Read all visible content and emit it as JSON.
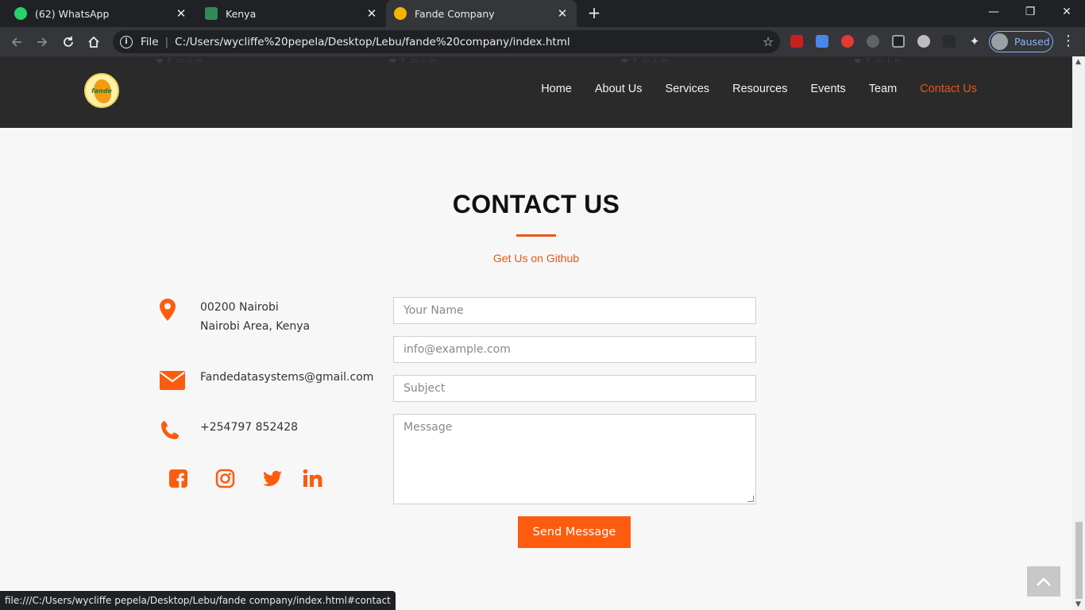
{
  "browser": {
    "tabs": [
      {
        "title": "(62) WhatsApp",
        "close": "✕",
        "favicon_color": "#25d366"
      },
      {
        "title": "Kenya",
        "close": "✕",
        "favicon_color": "#2e8b57"
      },
      {
        "title": "Fande Company",
        "close": "✕",
        "favicon_color": "#f4b400"
      }
    ],
    "new_tab": "+",
    "window": {
      "minimize": "—",
      "restore": "❐",
      "close": "✕"
    },
    "address": {
      "scheme_label": "File",
      "url": "C:/Users/wycliffe%20pepela/Desktop/Lebu/fande%20company/index.html"
    },
    "profile_status": "Paused",
    "status_bar": "file:///C:/Users/wycliffe pepela/Desktop/Lebu/fande company/index.html#contact"
  },
  "site": {
    "logo_text": "fande",
    "nav": [
      "Home",
      "About Us",
      "Services",
      "Resources",
      "Events",
      "Team",
      "Contact Us"
    ],
    "active_nav": "Contact Us"
  },
  "contact": {
    "title": "CONTACT US",
    "subtitle": "Get Us on Github",
    "address_line1": "00200 Nairobi",
    "address_line2": "Nairobi Area, Kenya",
    "email": "Fandedatasystems@gmail.com",
    "phone": "+254797 852428",
    "social": [
      "facebook-icon",
      "instagram-icon",
      "twitter-icon",
      "linkedin-icon"
    ],
    "form": {
      "name_placeholder": "Your Name",
      "email_placeholder": "info@example.com",
      "subject_placeholder": "Subject",
      "message_placeholder": "Message",
      "submit_label": "Send Message"
    }
  },
  "colors": {
    "accent": "#fd5c0e",
    "header_bg": "#2a2a2a",
    "page_bg": "#f7f7f7"
  }
}
